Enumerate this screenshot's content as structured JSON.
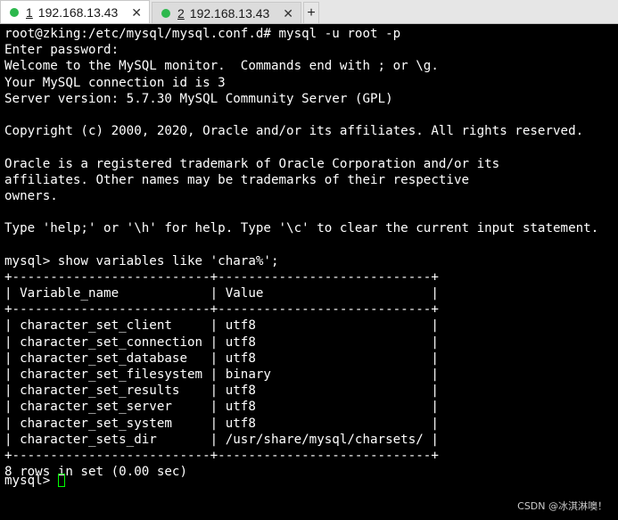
{
  "tabs": [
    {
      "number": "1",
      "title": "192.168.13.43",
      "active": true,
      "status_color": "#2db84d",
      "close": "✕"
    },
    {
      "number": "2",
      "title": "192.168.13.43",
      "active": false,
      "status_color": "#2db84d",
      "close": "✕"
    }
  ],
  "new_tab_label": "+",
  "terminal": {
    "lines": [
      "root@zking:/etc/mysql/mysql.conf.d# mysql -u root -p",
      "Enter password:",
      "Welcome to the MySQL monitor.  Commands end with ; or \\g.",
      "Your MySQL connection id is 3",
      "Server version: 5.7.30 MySQL Community Server (GPL)",
      "",
      "Copyright (c) 2000, 2020, Oracle and/or its affiliates. All rights reserved.",
      "",
      "Oracle is a registered trademark of Oracle Corporation and/or its",
      "affiliates. Other names may be trademarks of their respective",
      "owners.",
      "",
      "Type 'help;' or '\\h' for help. Type '\\c' to clear the current input statement.",
      "",
      "mysql> show variables like 'chara%';",
      "+--------------------------+----------------------------+",
      "| Variable_name            | Value                      |",
      "+--------------------------+----------------------------+",
      "| character_set_client     | utf8                       |",
      "| character_set_connection | utf8                       |",
      "| character_set_database   | utf8                       |",
      "| character_set_filesystem | binary                     |",
      "| character_set_results    | utf8                       |",
      "| character_set_server     | utf8                       |",
      "| character_set_system     | utf8                       |",
      "| character_sets_dir       | /usr/share/mysql/charsets/ |",
      "+--------------------------+----------------------------+",
      "8 rows in set (0.00 sec)"
    ],
    "prompt": "mysql> "
  },
  "watermark": "CSDN @冰淇淋噢！",
  "colors": {
    "background": "#000000",
    "text": "#ffffff",
    "cursor": "#00ff00",
    "tab_active": "#ffffff",
    "tab_inactive": "#dcdcdc"
  }
}
